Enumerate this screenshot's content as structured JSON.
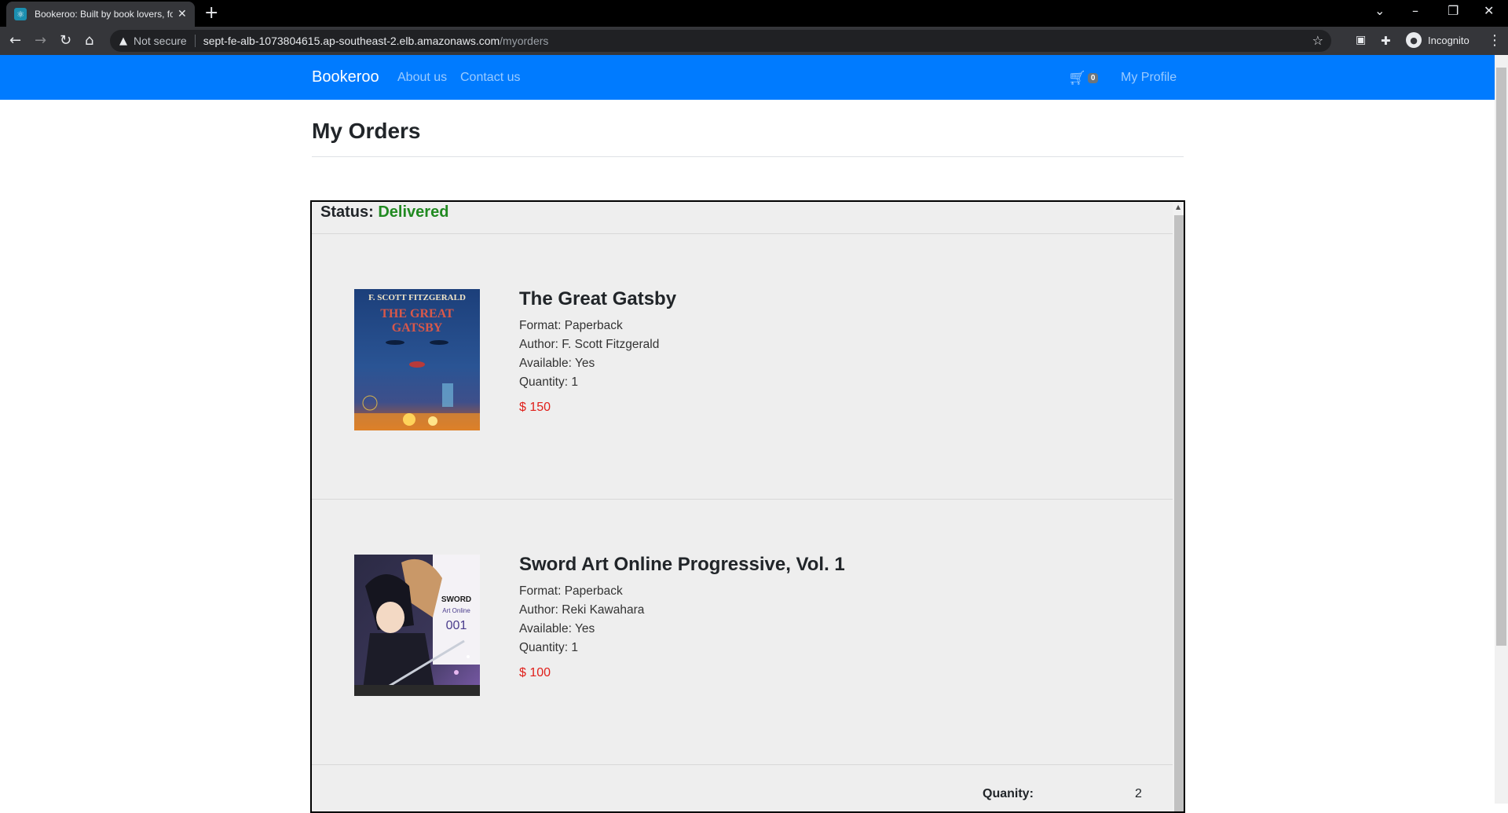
{
  "browser": {
    "tab_title": "Bookeroo: Built by book lovers, for book lovers",
    "tab_favicon_icon": "react-icon",
    "new_tab_symbol": "+",
    "not_secure_label": "Not secure",
    "url_host": "sept-fe-alb-1073804615.ap-southeast-2.elb.amazonaws.com",
    "url_path": "/myorders",
    "profile_label": "Incognito"
  },
  "navbar": {
    "brand": "Bookeroo",
    "links": [
      "About us",
      "Contact us"
    ],
    "cart_count": "0",
    "profile_link": "My Profile",
    "color": "#007bff"
  },
  "page": {
    "title": "My Orders"
  },
  "order": {
    "status_label": "Status:",
    "status_value": "Delivered",
    "status_color": "#218a21",
    "items": [
      {
        "title": "The Great Gatsby",
        "format": "Format: Paperback",
        "author": "Author: F. Scott Fitzgerald",
        "available": "Available: Yes",
        "quantity": "Quantity: 1",
        "price": "$ 150",
        "cover_author": "F. SCOTT FITZGERALD",
        "cover_title_1": "THE GREAT",
        "cover_title_2": "GATSBY"
      },
      {
        "title": "Sword Art Online Progressive, Vol. 1",
        "format": "Format: Paperback",
        "author": "Author: Reki Kawahara",
        "available": "Available: Yes",
        "quantity": "Quantity: 1",
        "price": "$ 100",
        "cover_title_1": "SWORD",
        "cover_title_2": "Art Online",
        "cover_title_3": "001"
      }
    ],
    "total_quantity_label": "Quanity:",
    "total_quantity_value": "2",
    "price_color": "#e0201b"
  }
}
